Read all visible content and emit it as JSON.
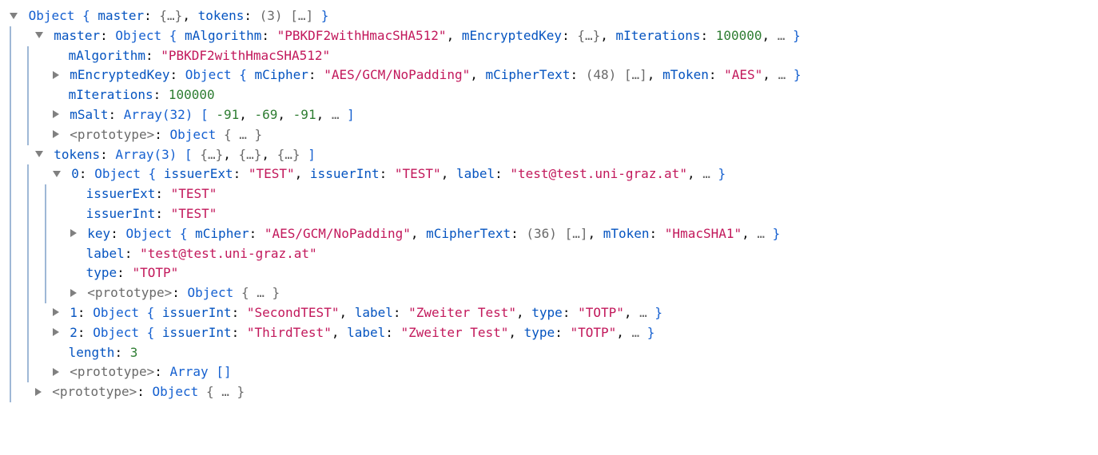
{
  "root": {
    "type": "Object",
    "master_key": "master",
    "tokens_key": "tokens",
    "tokens_count": "(3)",
    "ellipsis": "[…]",
    "brace_ell": "{…}",
    "more": "…"
  },
  "master": {
    "type": "Object",
    "mAlgorithm_key": "mAlgorithm",
    "mAlgorithm_val": "\"PBKDF2withHmacSHA512\"",
    "mEncryptedKey_key": "mEncryptedKey",
    "mIterations_key": "mIterations",
    "mIterations_val": "100000",
    "mSalt_key": "mSalt",
    "mSalt_type": "Array(32)",
    "mSalt_preview1": "-91",
    "mSalt_preview2": "-69",
    "mSalt_preview3": "-91",
    "encKey_type": "Object",
    "encKey_mCipher_key": "mCipher",
    "encKey_mCipher_val": "\"AES/GCM/NoPadding\"",
    "encKey_mCipherText_key": "mCipherText",
    "encKey_mCipherText_len": "(48)",
    "encKey_mToken_key": "mToken",
    "encKey_mToken_val": "\"AES\"",
    "prototype_label": "<prototype>",
    "prototype_type": "Object",
    "prototype_ell": "{ … }"
  },
  "tokens": {
    "type": "Array(3)",
    "length_key": "length",
    "length_val": "3",
    "proto_label": "<prototype>",
    "proto_type": "Array []"
  },
  "tok0": {
    "idx": "0",
    "type": "Object",
    "issuerExt_key": "issuerExt",
    "issuerExt_val": "\"TEST\"",
    "issuerInt_key": "issuerInt",
    "issuerInt_val": "\"TEST\"",
    "label_key": "label",
    "label_val": "\"test@test.uni-graz.at\"",
    "key_key": "key",
    "key_type": "Object",
    "key_mCipher_key": "mCipher",
    "key_mCipher_val": "\"AES/GCM/NoPadding\"",
    "key_mCipherText_key": "mCipherText",
    "key_mCipherText_len": "(36)",
    "key_mToken_key": "mToken",
    "key_mToken_val": "\"HmacSHA1\"",
    "type_key": "type",
    "type_val": "\"TOTP\"",
    "proto_label": "<prototype>",
    "proto_type": "Object",
    "proto_ell": "{ … }"
  },
  "tok1": {
    "idx": "1",
    "type": "Object",
    "issuerInt_key": "issuerInt",
    "issuerInt_val": "\"SecondTEST\"",
    "label_key": "label",
    "label_val": "\"Zweiter Test\"",
    "type_key": "type",
    "type_val": "\"TOTP\""
  },
  "tok2": {
    "idx": "2",
    "type": "Object",
    "issuerInt_key": "issuerInt",
    "issuerInt_val": "\"ThirdTest\"",
    "label_key": "label",
    "label_val": "\"Zweiter Test\"",
    "type_key": "type",
    "type_val": "\"TOTP\""
  },
  "outer_proto": {
    "label": "<prototype>",
    "type": "Object",
    "ell": "{ … }"
  }
}
